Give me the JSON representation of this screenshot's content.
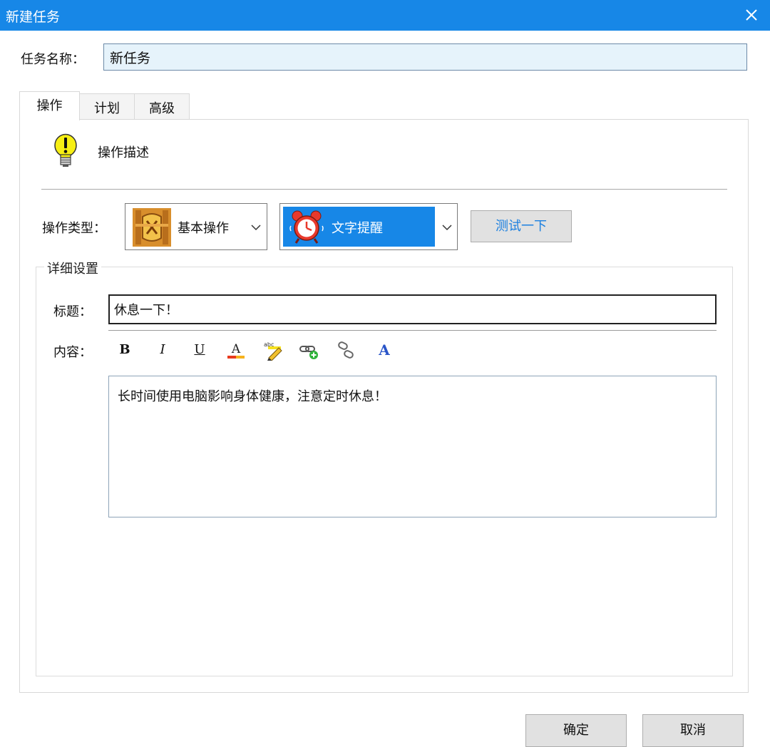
{
  "window": {
    "title": "新建任务"
  },
  "task_name": {
    "label": "任务名称：",
    "value": "新任务"
  },
  "tabs": [
    {
      "label": "操作",
      "active": true
    },
    {
      "label": "计划",
      "active": false
    },
    {
      "label": "高级",
      "active": false
    }
  ],
  "description": {
    "text": "操作描述",
    "icon": "lightbulb-icon"
  },
  "action_type": {
    "label": "操作类型：",
    "category": {
      "value": "基本操作",
      "icon": "basic-operation-icon"
    },
    "action": {
      "value": "文字提醒",
      "icon": "alarm-clock-icon",
      "selected_color": "#1787e7"
    },
    "test_button": "测试一下"
  },
  "details": {
    "group_label": "详细设置",
    "title_label": "标题：",
    "title_value": "休息一下！",
    "content_label": "内容：",
    "toolbar": [
      "bold",
      "italic",
      "underline",
      "font-color",
      "highlight",
      "insert-link",
      "remove-link",
      "font"
    ],
    "content_value": "长时间使用电脑影响身体健康，注意定时休息！"
  },
  "buttons": {
    "ok": "确定",
    "cancel": "取消"
  },
  "colors": {
    "titlebar": "#1787e7",
    "name_field_bg": "#e6f3fb",
    "test_button_text": "#1a7fe0"
  }
}
